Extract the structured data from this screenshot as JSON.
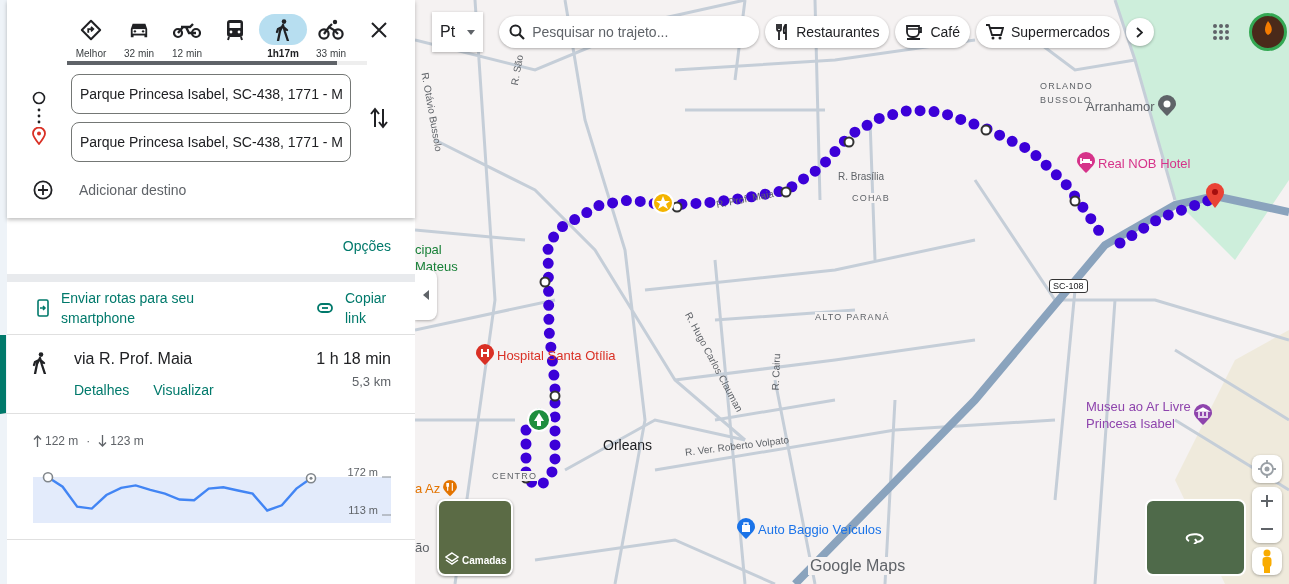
{
  "modes": [
    {
      "kind": "best",
      "label": "Melhor",
      "selected": false
    },
    {
      "kind": "car",
      "label": "32 min",
      "selected": false
    },
    {
      "kind": "motorcycle",
      "label": "12 min",
      "selected": false
    },
    {
      "kind": "transit",
      "selected": false
    },
    {
      "kind": "walk",
      "label": "1h17m",
      "selected": true
    },
    {
      "kind": "bike",
      "label": "33 min",
      "selected": false
    }
  ],
  "loading_bar": {
    "level": 0.9
  },
  "stops": [
    {
      "kind": "origin",
      "value": "Parque Princesa Isabel, SC-438, 1771 - M"
    },
    {
      "kind": "destination",
      "value": "Parque Princesa Isabel, SC-438, 1771 - M"
    }
  ],
  "add_destination": "Adicionar destino",
  "options_link": "Opções",
  "send_to_phone": "Enviar rotas para seu smartphone",
  "copy_link": "Copiar link",
  "route": {
    "name": "via R. Prof. Maia",
    "duration": "1 h 18 min",
    "distance": "5,3 km",
    "details_link": "Detalhes",
    "preview_link": "Visualizar",
    "selected": true
  },
  "elevation": {
    "ascent": "122 m",
    "descent": "123 m",
    "separator": "·",
    "scale_labels": [
      "172 m",
      "113 m"
    ]
  },
  "map": {
    "map_type_label": "Pt",
    "search": {
      "placeholder": "Pesquisar no trajeto..."
    },
    "chips": [
      {
        "kind": "restaurant",
        "label": "Restaurantes"
      },
      {
        "kind": "cafe",
        "label": "Café"
      },
      {
        "kind": "grocery",
        "label": "Supermercados"
      }
    ],
    "streets": [
      {
        "text": "R. Otávio Bussolo"
      },
      {
        "text": "R. São"
      },
      {
        "text": "R. Prof. Maia"
      },
      {
        "text": "R. Brasília"
      },
      {
        "text": "R. Hugo Carlos Clauman"
      },
      {
        "text": "R. Cairu"
      },
      {
        "text": "R. Ver. Roberto Volpato"
      }
    ],
    "areas": [
      {
        "text": "ORLANDO"
      },
      {
        "text": "BUSSOLO"
      },
      {
        "text": "COHAB"
      },
      {
        "text": "ALTO PARANÁ"
      },
      {
        "text": "CENTRO"
      }
    ],
    "town": "Orleans",
    "road_shield": "SC-108",
    "places": [
      {
        "lines": [
          "Arranhamor"
        ],
        "color": "#5f6368",
        "kind": "pin"
      },
      {
        "lines": [
          "Real NOB Hotel"
        ],
        "color": "#d6338a",
        "kind": "hotel"
      },
      {
        "lines": [
          "cipal",
          "Mateus"
        ],
        "color": "#188038"
      },
      {
        "lines": [
          "Hospital Santa Otília"
        ],
        "color": "#d93025",
        "kind": "hospital"
      },
      {
        "lines": [
          "Museu ao Ar Livre",
          "Princesa Isabel"
        ],
        "color": "#8e44ad",
        "kind": "museum"
      },
      {
        "lines": [
          "Auto Baggio Veículos"
        ],
        "color": "#1a73e8",
        "kind": "shop"
      },
      {
        "lines": [
          "a Az"
        ],
        "color": "#e37400",
        "kind": "food"
      },
      {
        "lines": [
          "ão"
        ],
        "color": "#5f6368"
      }
    ],
    "layers_label": "Camadas",
    "attribution": "Google Maps"
  }
}
